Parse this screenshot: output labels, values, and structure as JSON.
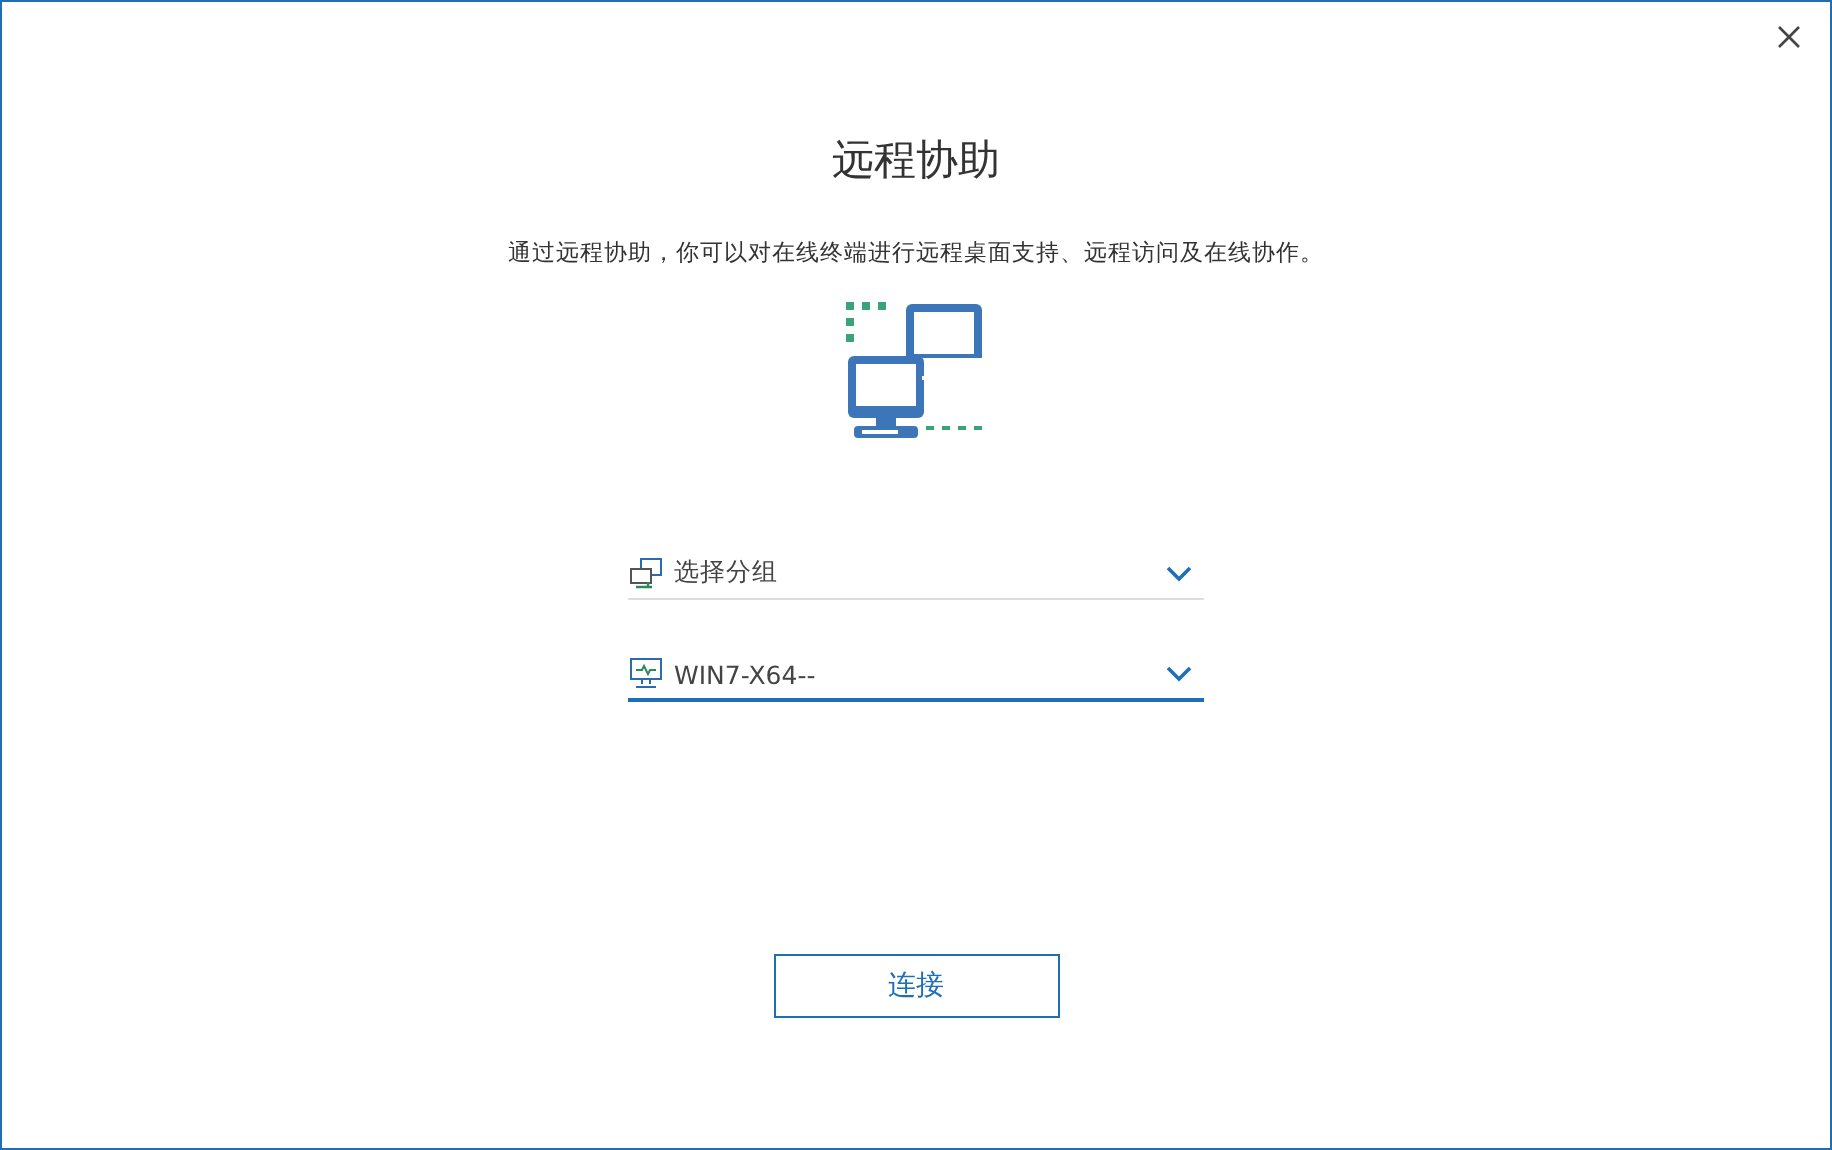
{
  "dialog": {
    "title": "远程协助",
    "description": "通过远程协助，你可以对在线终端进行远程桌面支持、远程访问及在线协作。"
  },
  "selects": [
    {
      "kind": "group",
      "value": "选择分组",
      "active": false
    },
    {
      "kind": "computer",
      "value": "WIN7-X64--",
      "active": true
    }
  ],
  "connect_button": "连接"
}
